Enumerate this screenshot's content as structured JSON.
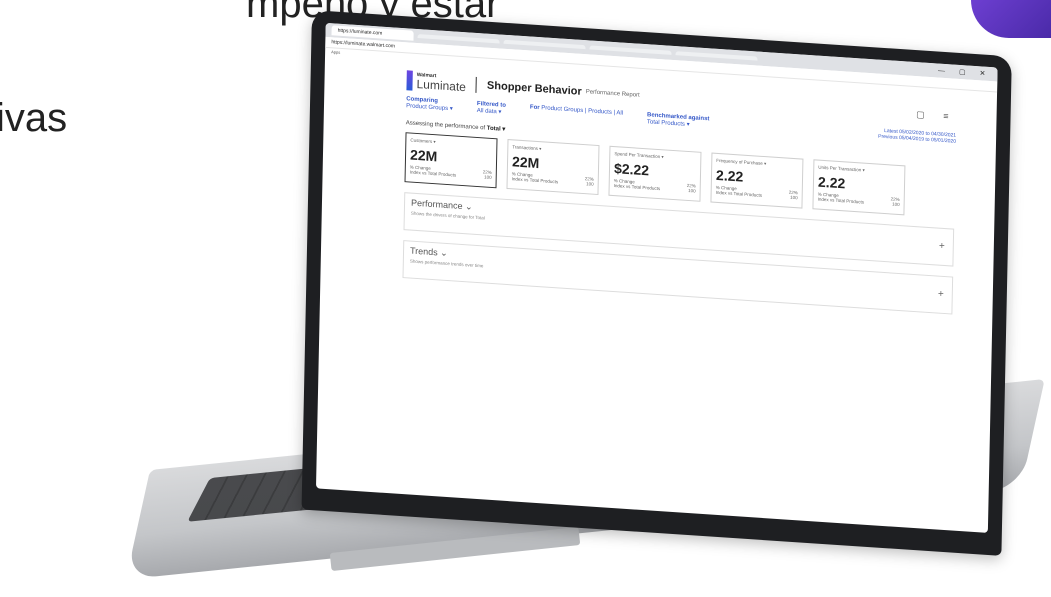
{
  "slide": {
    "line1": "mpeño y estar",
    "line2": "ivas"
  },
  "browser": {
    "tabs": [
      "https://luminate.com",
      "",
      "",
      "",
      ""
    ],
    "url": "https://luminate.walmart.com",
    "bookmark": "Apps"
  },
  "app": {
    "brand_small": "Walmart",
    "brand_main": "Luminate",
    "title": "Shopper Behavior",
    "subtitle": "Performance Report"
  },
  "filters": {
    "comparing_label": "Comparing",
    "comparing_value": "Product Groups ▾",
    "filtered_label": "Filtered to",
    "filtered_value": "All data ▾",
    "for_label": "For",
    "for_value": "Product Groups | Products | All",
    "benchmark_label": "Benchmarked against",
    "benchmark_value": "Total Products ▾",
    "latest": "Latest 05/02/2020 to 04/30/2021",
    "previous": "Previous 05/04/2019 to 05/01/2020"
  },
  "assess": {
    "label": "Assessing the performance of",
    "value": "Total ▾"
  },
  "kpis": [
    {
      "name": "Customers ▾",
      "value": "22M",
      "change_label": "% Change",
      "change": "22%",
      "index_label": "Index vs Total Products",
      "index": "100"
    },
    {
      "name": "Transactions ▾",
      "value": "22M",
      "change_label": "% Change",
      "change": "22%",
      "index_label": "Index vs Total Products",
      "index": "100"
    },
    {
      "name": "Spend Per Transaction ▾",
      "value": "$2.22",
      "change_label": "% Change",
      "change": "22%",
      "index_label": "Index vs Total Products",
      "index": "100"
    },
    {
      "name": "Frequency of Purchase ▾",
      "value": "2.22",
      "change_label": "% Change",
      "change": "22%",
      "index_label": "Index vs Total Products",
      "index": "100"
    },
    {
      "name": "Units Per Transaction ▾",
      "value": "2.22",
      "change_label": "% Change",
      "change": "22%",
      "index_label": "Index vs Total Products",
      "index": "100"
    }
  ],
  "sections": [
    {
      "title": "Performance ⌄",
      "desc": "Shows the drivers of change for Total"
    },
    {
      "title": "Trends ⌄",
      "desc": "Shows performance trends over time"
    }
  ],
  "icons": {
    "plus": "+",
    "calendar": "▢",
    "menu": "≡",
    "window": "— ▢ ✕"
  }
}
